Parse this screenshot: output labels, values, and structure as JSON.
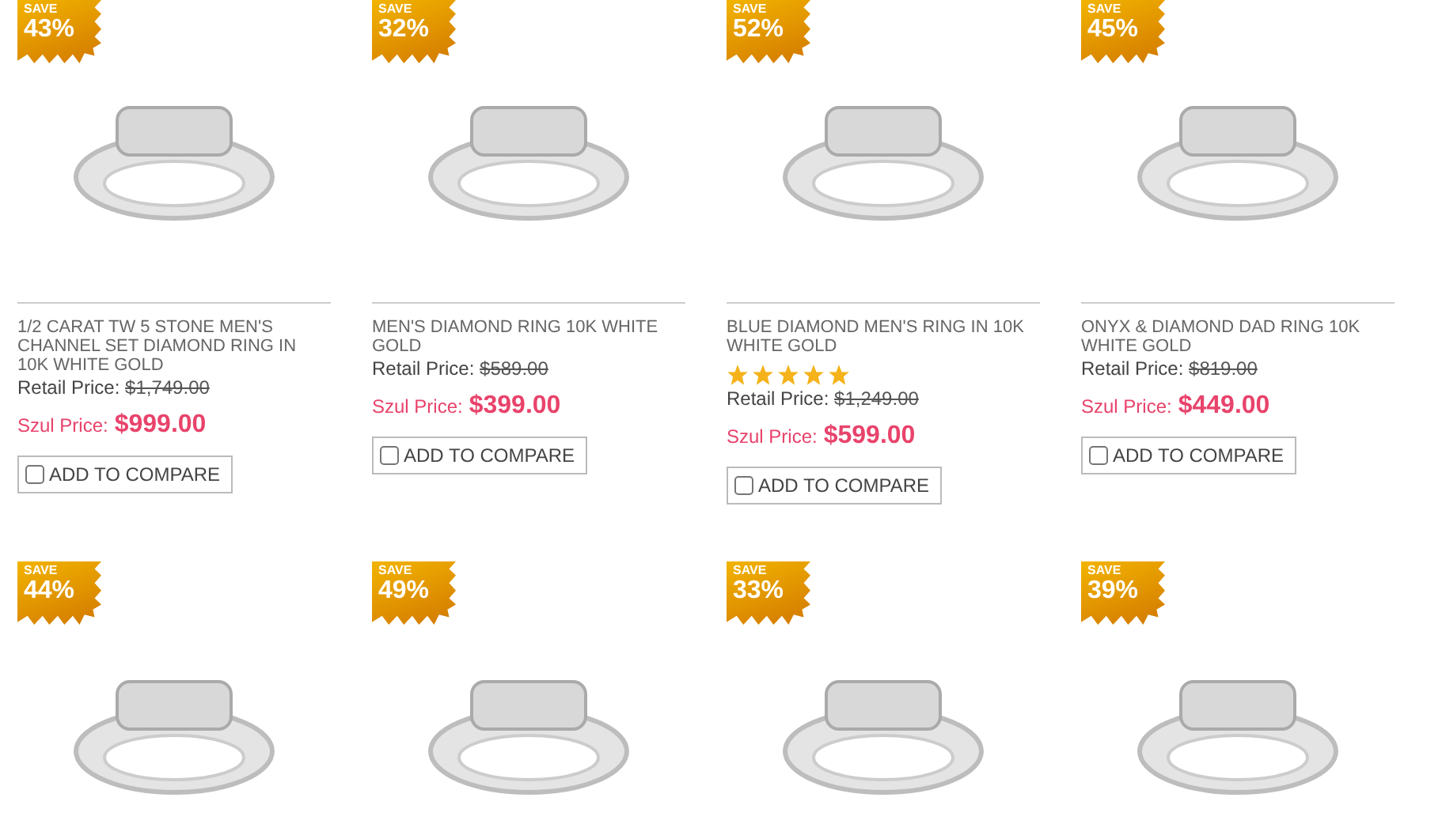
{
  "products": [
    {
      "save_label": "SAVE",
      "discount": "43%",
      "title": "1/2 CARAT TW 5 STONE MEN'S CHANNEL SET DIAMOND RING IN 10K WHITE GOLD",
      "retail_label": "Retail Price:",
      "retail_price": "$1,749.00",
      "sale_label": "Szul Price:",
      "sale_price": "$999.00",
      "compare": {
        "label": "ADD TO COMPARE",
        "checked": false
      }
    },
    {
      "save_label": "SAVE",
      "discount": "32%",
      "title": "MEN'S DIAMOND RING 10K WHITE GOLD",
      "retail_label": "Retail Price:",
      "retail_price": "$589.00",
      "sale_label": "Szul Price:",
      "sale_price": "$399.00",
      "compare": {
        "label": "ADD TO COMPARE",
        "checked": false
      }
    },
    {
      "save_label": "SAVE",
      "discount": "52%",
      "title": "BLUE DIAMOND MEN'S RING IN 10K WHITE GOLD",
      "stars": 5,
      "retail_label": "Retail Price:",
      "retail_price": "$1,249.00",
      "sale_label": "Szul Price:",
      "sale_price": "$599.00",
      "compare": {
        "label": "ADD TO COMPARE",
        "checked": false
      }
    },
    {
      "save_label": "SAVE",
      "discount": "45%",
      "title": "ONYX & DIAMOND DAD RING 10K WHITE GOLD",
      "retail_label": "Retail Price:",
      "retail_price": "$819.00",
      "sale_label": "Szul Price:",
      "sale_price": "$449.00",
      "compare": {
        "label": "ADD TO COMPARE",
        "checked": false
      }
    },
    {
      "save_label": "SAVE",
      "discount": "44%"
    },
    {
      "save_label": "SAVE",
      "discount": "49%"
    },
    {
      "save_label": "SAVE",
      "discount": "33%"
    },
    {
      "save_label": "SAVE",
      "discount": "39%"
    }
  ]
}
